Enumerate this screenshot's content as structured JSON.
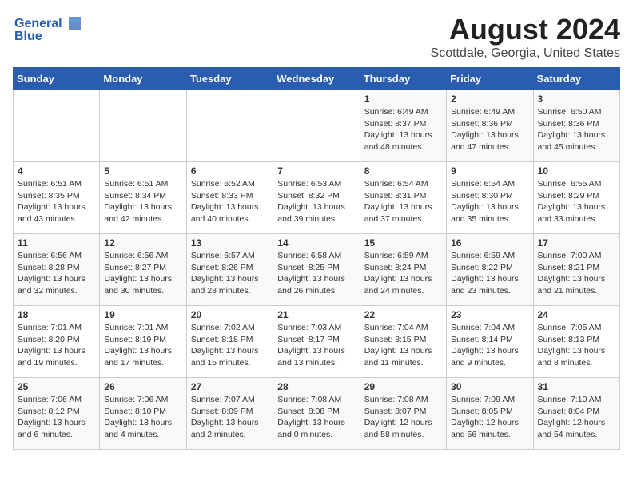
{
  "logo": {
    "line1": "General",
    "line2": "Blue"
  },
  "title": "August 2024",
  "location": "Scottdale, Georgia, United States",
  "weekdays": [
    "Sunday",
    "Monday",
    "Tuesday",
    "Wednesday",
    "Thursday",
    "Friday",
    "Saturday"
  ],
  "weeks": [
    [
      {
        "day": "",
        "sunrise": "",
        "sunset": "",
        "daylight": ""
      },
      {
        "day": "",
        "sunrise": "",
        "sunset": "",
        "daylight": ""
      },
      {
        "day": "",
        "sunrise": "",
        "sunset": "",
        "daylight": ""
      },
      {
        "day": "",
        "sunrise": "",
        "sunset": "",
        "daylight": ""
      },
      {
        "day": "1",
        "sunrise": "Sunrise: 6:49 AM",
        "sunset": "Sunset: 8:37 PM",
        "daylight": "Daylight: 13 hours and 48 minutes."
      },
      {
        "day": "2",
        "sunrise": "Sunrise: 6:49 AM",
        "sunset": "Sunset: 8:36 PM",
        "daylight": "Daylight: 13 hours and 47 minutes."
      },
      {
        "day": "3",
        "sunrise": "Sunrise: 6:50 AM",
        "sunset": "Sunset: 8:36 PM",
        "daylight": "Daylight: 13 hours and 45 minutes."
      }
    ],
    [
      {
        "day": "4",
        "sunrise": "Sunrise: 6:51 AM",
        "sunset": "Sunset: 8:35 PM",
        "daylight": "Daylight: 13 hours and 43 minutes."
      },
      {
        "day": "5",
        "sunrise": "Sunrise: 6:51 AM",
        "sunset": "Sunset: 8:34 PM",
        "daylight": "Daylight: 13 hours and 42 minutes."
      },
      {
        "day": "6",
        "sunrise": "Sunrise: 6:52 AM",
        "sunset": "Sunset: 8:33 PM",
        "daylight": "Daylight: 13 hours and 40 minutes."
      },
      {
        "day": "7",
        "sunrise": "Sunrise: 6:53 AM",
        "sunset": "Sunset: 8:32 PM",
        "daylight": "Daylight: 13 hours and 39 minutes."
      },
      {
        "day": "8",
        "sunrise": "Sunrise: 6:54 AM",
        "sunset": "Sunset: 8:31 PM",
        "daylight": "Daylight: 13 hours and 37 minutes."
      },
      {
        "day": "9",
        "sunrise": "Sunrise: 6:54 AM",
        "sunset": "Sunset: 8:30 PM",
        "daylight": "Daylight: 13 hours and 35 minutes."
      },
      {
        "day": "10",
        "sunrise": "Sunrise: 6:55 AM",
        "sunset": "Sunset: 8:29 PM",
        "daylight": "Daylight: 13 hours and 33 minutes."
      }
    ],
    [
      {
        "day": "11",
        "sunrise": "Sunrise: 6:56 AM",
        "sunset": "Sunset: 8:28 PM",
        "daylight": "Daylight: 13 hours and 32 minutes."
      },
      {
        "day": "12",
        "sunrise": "Sunrise: 6:56 AM",
        "sunset": "Sunset: 8:27 PM",
        "daylight": "Daylight: 13 hours and 30 minutes."
      },
      {
        "day": "13",
        "sunrise": "Sunrise: 6:57 AM",
        "sunset": "Sunset: 8:26 PM",
        "daylight": "Daylight: 13 hours and 28 minutes."
      },
      {
        "day": "14",
        "sunrise": "Sunrise: 6:58 AM",
        "sunset": "Sunset: 8:25 PM",
        "daylight": "Daylight: 13 hours and 26 minutes."
      },
      {
        "day": "15",
        "sunrise": "Sunrise: 6:59 AM",
        "sunset": "Sunset: 8:24 PM",
        "daylight": "Daylight: 13 hours and 24 minutes."
      },
      {
        "day": "16",
        "sunrise": "Sunrise: 6:59 AM",
        "sunset": "Sunset: 8:22 PM",
        "daylight": "Daylight: 13 hours and 23 minutes."
      },
      {
        "day": "17",
        "sunrise": "Sunrise: 7:00 AM",
        "sunset": "Sunset: 8:21 PM",
        "daylight": "Daylight: 13 hours and 21 minutes."
      }
    ],
    [
      {
        "day": "18",
        "sunrise": "Sunrise: 7:01 AM",
        "sunset": "Sunset: 8:20 PM",
        "daylight": "Daylight: 13 hours and 19 minutes."
      },
      {
        "day": "19",
        "sunrise": "Sunrise: 7:01 AM",
        "sunset": "Sunset: 8:19 PM",
        "daylight": "Daylight: 13 hours and 17 minutes."
      },
      {
        "day": "20",
        "sunrise": "Sunrise: 7:02 AM",
        "sunset": "Sunset: 8:18 PM",
        "daylight": "Daylight: 13 hours and 15 minutes."
      },
      {
        "day": "21",
        "sunrise": "Sunrise: 7:03 AM",
        "sunset": "Sunset: 8:17 PM",
        "daylight": "Daylight: 13 hours and 13 minutes."
      },
      {
        "day": "22",
        "sunrise": "Sunrise: 7:04 AM",
        "sunset": "Sunset: 8:15 PM",
        "daylight": "Daylight: 13 hours and 11 minutes."
      },
      {
        "day": "23",
        "sunrise": "Sunrise: 7:04 AM",
        "sunset": "Sunset: 8:14 PM",
        "daylight": "Daylight: 13 hours and 9 minutes."
      },
      {
        "day": "24",
        "sunrise": "Sunrise: 7:05 AM",
        "sunset": "Sunset: 8:13 PM",
        "daylight": "Daylight: 13 hours and 8 minutes."
      }
    ],
    [
      {
        "day": "25",
        "sunrise": "Sunrise: 7:06 AM",
        "sunset": "Sunset: 8:12 PM",
        "daylight": "Daylight: 13 hours and 6 minutes."
      },
      {
        "day": "26",
        "sunrise": "Sunrise: 7:06 AM",
        "sunset": "Sunset: 8:10 PM",
        "daylight": "Daylight: 13 hours and 4 minutes."
      },
      {
        "day": "27",
        "sunrise": "Sunrise: 7:07 AM",
        "sunset": "Sunset: 8:09 PM",
        "daylight": "Daylight: 13 hours and 2 minutes."
      },
      {
        "day": "28",
        "sunrise": "Sunrise: 7:08 AM",
        "sunset": "Sunset: 8:08 PM",
        "daylight": "Daylight: 13 hours and 0 minutes."
      },
      {
        "day": "29",
        "sunrise": "Sunrise: 7:08 AM",
        "sunset": "Sunset: 8:07 PM",
        "daylight": "Daylight: 12 hours and 58 minutes."
      },
      {
        "day": "30",
        "sunrise": "Sunrise: 7:09 AM",
        "sunset": "Sunset: 8:05 PM",
        "daylight": "Daylight: 12 hours and 56 minutes."
      },
      {
        "day": "31",
        "sunrise": "Sunrise: 7:10 AM",
        "sunset": "Sunset: 8:04 PM",
        "daylight": "Daylight: 12 hours and 54 minutes."
      }
    ]
  ]
}
